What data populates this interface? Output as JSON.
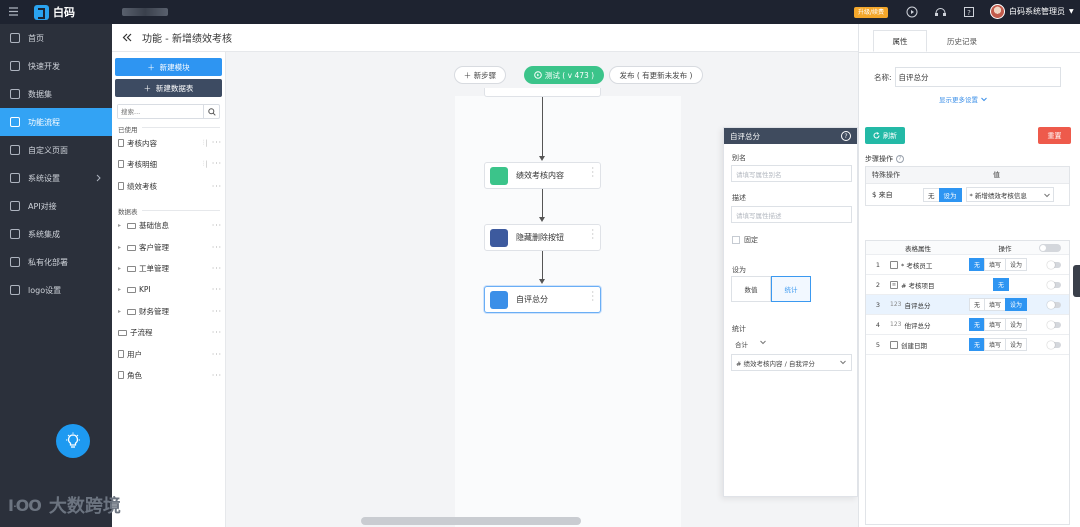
{
  "topbar": {
    "brand": "白码",
    "upgrade_badge": "升级/续费",
    "user_name": "白码系统管理员"
  },
  "sidebar": {
    "items": [
      {
        "label": "首页",
        "icon": "home-icon"
      },
      {
        "label": "快速开发",
        "icon": "cube-icon"
      },
      {
        "label": "数据集",
        "icon": "database-icon"
      },
      {
        "label": "功能流程",
        "icon": "flow-icon",
        "active": true
      },
      {
        "label": "自定义页面",
        "icon": "page-icon"
      },
      {
        "label": "系统设置",
        "icon": "monitor-icon",
        "expandable": true
      },
      {
        "label": "API对接",
        "icon": "api-icon"
      },
      {
        "label": "系统集成",
        "icon": "layers-icon"
      },
      {
        "label": "私有化部署",
        "icon": "server-icon"
      },
      {
        "label": "logo设置",
        "icon": "logo-icon"
      }
    ]
  },
  "header": {
    "title": "功能 - 新增绩效考核"
  },
  "tree": {
    "new_module": "新建模块",
    "new_table": "新建数据表",
    "search_placeholder": "搜索...",
    "used_section": "已使用",
    "used_items": [
      "考核内容",
      "考核明细",
      "绩效考核"
    ],
    "tables_section": "数据表",
    "folders": [
      "基础信息",
      "客户管理",
      "工单管理",
      "KPI",
      "财务管理"
    ],
    "extra_items": [
      "子流程",
      "用户",
      "角色"
    ]
  },
  "canvas": {
    "add_step": "新步骤",
    "test_label": "测试 ( v 473 )",
    "publish_label": "发布 ( 有更新未发布 )",
    "nodes": [
      {
        "label": "绩效考核内容",
        "color": "#3bc48a"
      },
      {
        "label": "隐藏删除按钮",
        "color": "#3d5a9e"
      },
      {
        "label": "自评总分",
        "color": "#3b8fe8"
      }
    ]
  },
  "popup": {
    "title": "自评总分",
    "alias_label": "别名",
    "alias_placeholder": "请填写属性别名",
    "desc_label": "描述",
    "desc_placeholder": "请填写属性描述",
    "fixed_label": "固定",
    "set_as_label": "设为",
    "set_as_options": [
      "数值",
      "统计"
    ],
    "stat_label": "统计",
    "stat_func": "合计",
    "stat_source": "# 绩效考核内容 / 自我评分"
  },
  "right_panel": {
    "tabs": [
      "属性",
      "历史记录"
    ],
    "name_label": "名称:",
    "name_value": "自评总分",
    "more_settings": "显示更多设置",
    "refresh": "刷新",
    "reset": "重置",
    "step_ops": "步骤操作",
    "ops_headers": [
      "特殊操作",
      "值"
    ],
    "ops_row": {
      "name": "$ 来自",
      "none": "无",
      "set": "设为",
      "source": "* 新增绩效考核信息"
    },
    "attr_headers": [
      "表格属性",
      "操作"
    ],
    "attr_rows": [
      {
        "idx": "1",
        "name": "* 考核员工",
        "ops": [
          "无",
          "填写",
          "设为"
        ],
        "active": 0
      },
      {
        "idx": "2",
        "name": "# 考核项目",
        "ops": [
          "无"
        ],
        "active": 0
      },
      {
        "idx": "3",
        "name": "自评总分",
        "ops": [
          "无",
          "填写",
          "设为"
        ],
        "active": 2
      },
      {
        "idx": "4",
        "name": "他评总分",
        "ops": [
          "无",
          "填写",
          "设为"
        ],
        "active": 0
      },
      {
        "idx": "5",
        "name": "创建日期",
        "ops": [
          "无",
          "填写",
          "设为"
        ],
        "active": 0
      }
    ]
  },
  "watermark": "大数跨境",
  "colors": {
    "accent": "#2e95f2",
    "sidebar_bg": "#2b303b",
    "topbar_bg": "#1e2330",
    "test_green": "#3bc48a",
    "reset_red": "#ee5a4b",
    "refresh_teal": "#23b9a6"
  }
}
